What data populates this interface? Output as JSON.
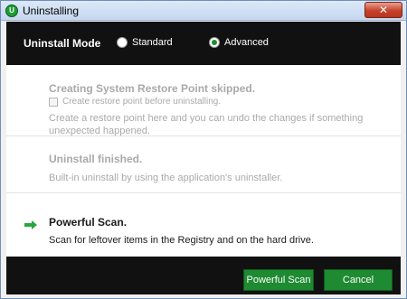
{
  "window": {
    "title": "Uninstalling",
    "app_icon_letter": "U",
    "close_glyph": "✕"
  },
  "mode": {
    "label": "Uninstall Mode",
    "options": [
      {
        "label": "Standard",
        "selected": false
      },
      {
        "label": "Advanced",
        "selected": true
      }
    ]
  },
  "steps": [
    {
      "title": "Creating System Restore Point skipped.",
      "checkbox_label": "Create restore point before uninstalling.",
      "checkbox_checked": false,
      "description": "Create a restore point here and you can undo the changes if something unexpected happened.",
      "state": "skipped"
    },
    {
      "title": "Uninstall finished.",
      "description": "Built-in uninstall by using the application's uninstaller.",
      "state": "done"
    },
    {
      "title": "Powerful Scan.",
      "description": "Scan for leftover items in the Registry and on the hard drive.",
      "state": "current",
      "icon": "green-arrow-icon"
    }
  ],
  "buttons": {
    "scan_label": "Powerful Scan",
    "cancel_label": "Cancel"
  },
  "colors": {
    "accent": "#1e8a32",
    "header_bg": "#111111",
    "close": "#c7422b"
  }
}
